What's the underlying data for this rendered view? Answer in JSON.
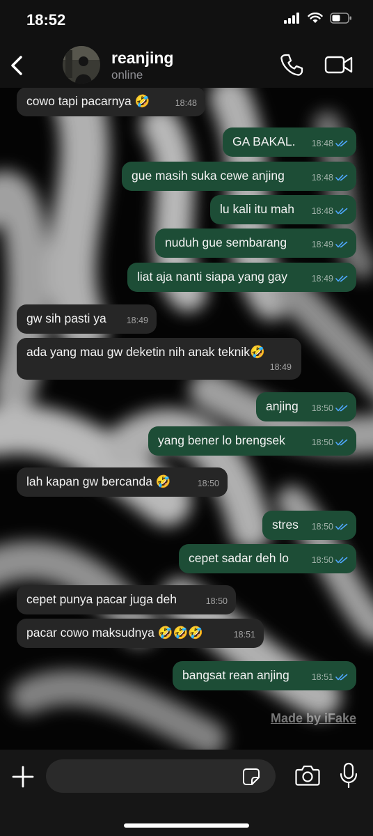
{
  "status_bar": {
    "time": "18:52"
  },
  "header": {
    "contact_name": "reanjing",
    "contact_status": "online"
  },
  "messages": [
    {
      "text": "cowo tapi pacarnya 🤣",
      "time": "18:48",
      "direction": "in"
    },
    {
      "text": "GA BAKAL.",
      "time": "18:48",
      "direction": "out",
      "read": true
    },
    {
      "text": "gue masih suka cewe anjing",
      "time": "18:48",
      "direction": "out",
      "read": true
    },
    {
      "text": "lu kali itu mah",
      "time": "18:48",
      "direction": "out",
      "read": true
    },
    {
      "text": "nuduh gue sembarang",
      "time": "18:49",
      "direction": "out",
      "read": true
    },
    {
      "text": "liat aja nanti siapa yang gay",
      "time": "18:49",
      "direction": "out",
      "read": true
    },
    {
      "text": "gw sih pasti ya",
      "time": "18:49",
      "direction": "in"
    },
    {
      "text": "ada yang mau gw deketin nih anak teknik🤣",
      "time": "18:49",
      "direction": "in"
    },
    {
      "text": "anjing",
      "time": "18:50",
      "direction": "out",
      "read": true
    },
    {
      "text": "yang bener lo brengsek",
      "time": "18:50",
      "direction": "out",
      "read": true
    },
    {
      "text": "lah kapan gw bercanda 🤣",
      "time": "18:50",
      "direction": "in"
    },
    {
      "text": "stres",
      "time": "18:50",
      "direction": "out",
      "read": true
    },
    {
      "text": "cepet sadar deh lo",
      "time": "18:50",
      "direction": "out",
      "read": true
    },
    {
      "text": "cepet punya pacar juga deh",
      "time": "18:50",
      "direction": "in"
    },
    {
      "text": "pacar cowo maksudnya 🤣🤣🤣",
      "time": "18:51",
      "direction": "in"
    },
    {
      "text": "bangsat rean anjing",
      "time": "18:51",
      "direction": "out",
      "read": true
    }
  ],
  "watermark": "Made by iFake",
  "input": {
    "placeholder": "",
    "value": ""
  },
  "colors": {
    "outgoing_bubble": "#1d4d36",
    "incoming_bubble": "#262626",
    "read_tick": "#4fa8ff",
    "header_background": "#111111"
  },
  "icons": {
    "back": "chevron-left-icon",
    "call": "phone-icon",
    "video": "video-camera-icon",
    "add": "plus-icon",
    "sticker": "sticker-icon",
    "camera": "camera-icon",
    "mic": "microphone-icon"
  }
}
